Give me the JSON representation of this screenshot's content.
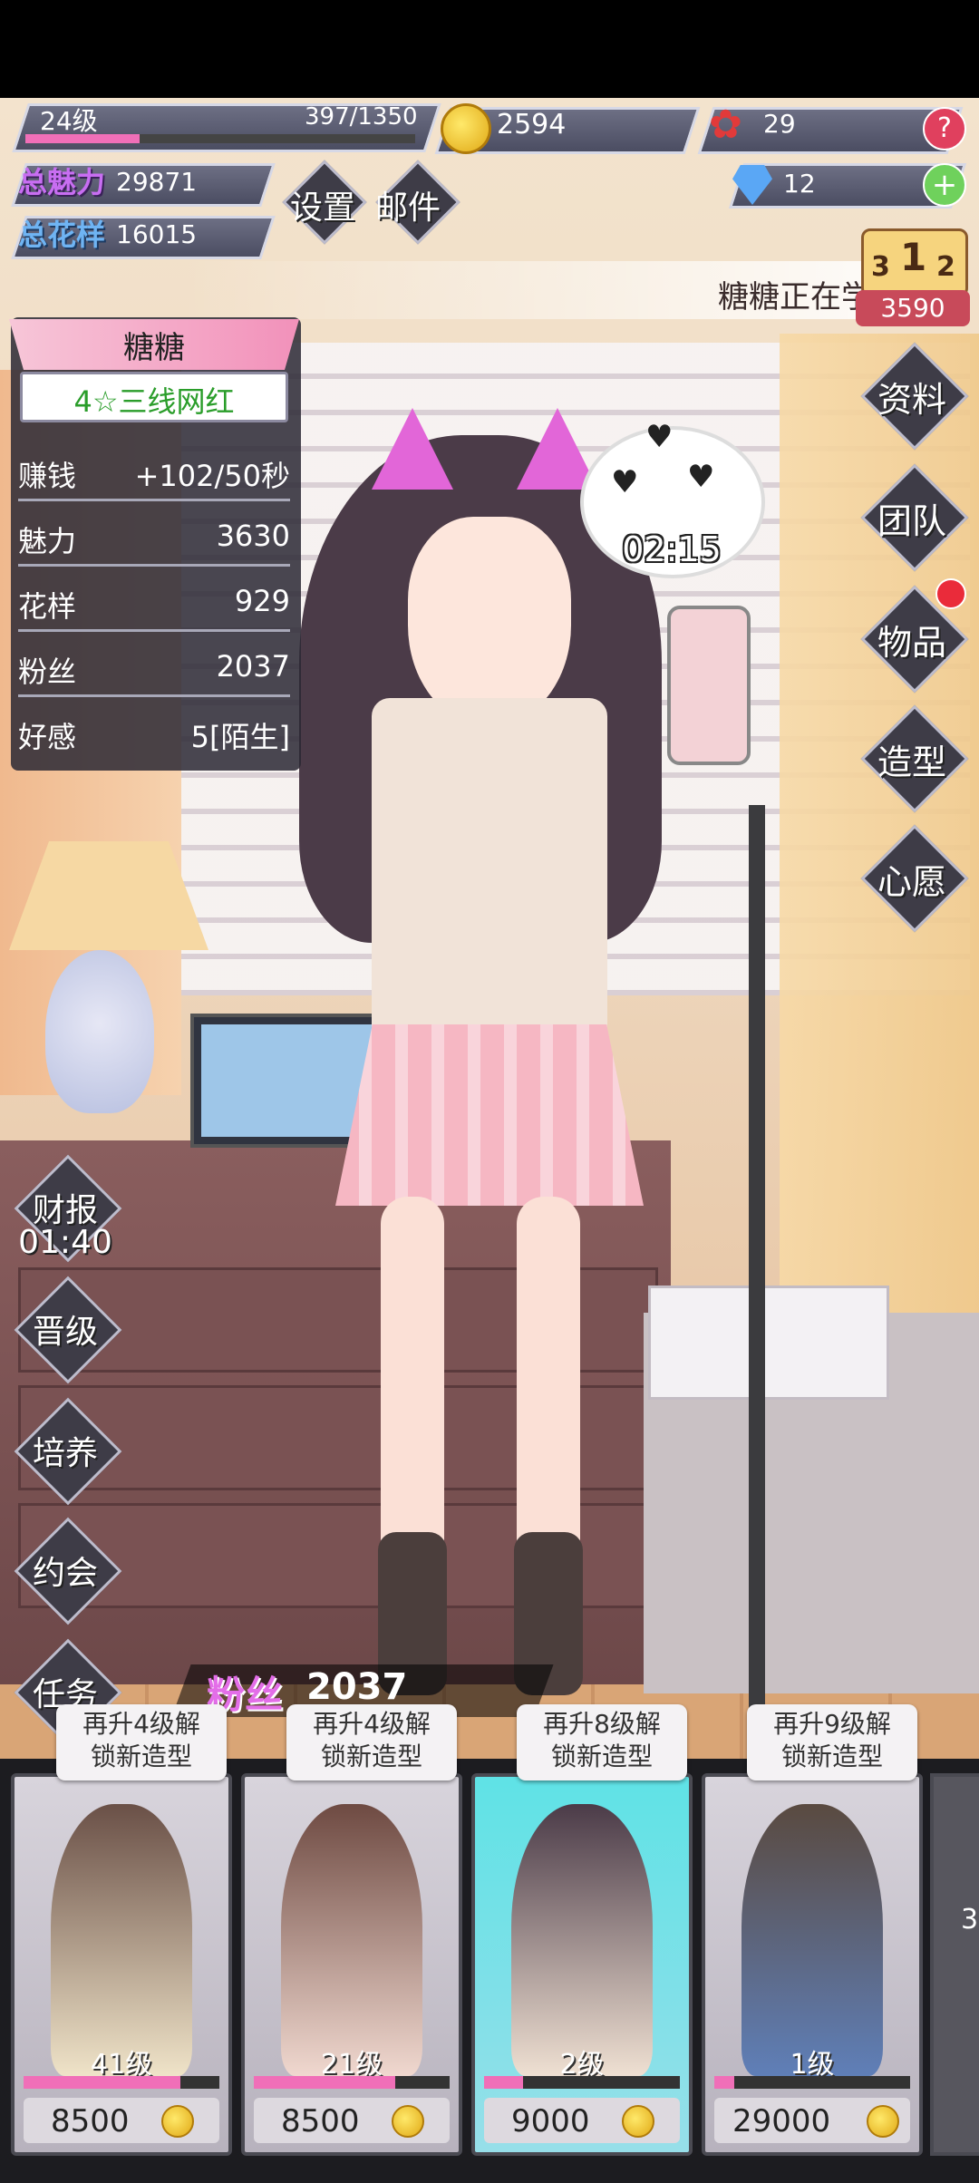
{
  "header": {
    "level": "24级",
    "exp": "397/1350",
    "exp_fraction": 0.294,
    "coins": "2594",
    "roses": "29",
    "diamonds": "12",
    "charm_label": "总魅力",
    "charm_value": "29871",
    "pattern_label": "总花样",
    "pattern_value": "16015",
    "settings": "设置",
    "mail": "邮件",
    "help_glyph": "?",
    "plus_glyph": "+"
  },
  "ticker": {
    "text": "糖糖正在学",
    "rank_digits": [
      "3",
      "1",
      "2"
    ],
    "rank_score": "3590"
  },
  "profile": {
    "name": "糖糖",
    "rank_title": "4☆三线网红",
    "stats": [
      {
        "label": "赚钱",
        "value": "+102/50秒"
      },
      {
        "label": "魅力",
        "value": "3630"
      },
      {
        "label": "花样",
        "value": "929"
      },
      {
        "label": "粉丝",
        "value": "2037"
      },
      {
        "label": "好感",
        "value": "5[陌生]"
      }
    ]
  },
  "bubble": {
    "time": "02:15"
  },
  "right_menu": [
    "资料",
    "团队",
    "物品",
    "造型",
    "心愿"
  ],
  "left_menu": {
    "report": "财报",
    "report_timer": "01:40",
    "promote": "晋级",
    "train": "培养",
    "date": "约会",
    "task": "任务"
  },
  "fans": {
    "label": "粉丝",
    "value": "2037"
  },
  "cards": [
    {
      "tip_line1": "再升4级解",
      "tip_line2": "锁新造型",
      "level": "41级",
      "progress": 0.8,
      "price": "8500"
    },
    {
      "tip_line1": "再升4级解",
      "tip_line2": "锁新造型",
      "level": "21级",
      "progress": 0.72,
      "price": "8500"
    },
    {
      "tip_line1": "再升8级解",
      "tip_line2": "锁新造型",
      "level": "2级",
      "progress": 0.2,
      "price": "9000"
    },
    {
      "tip_line1": "再升9级解",
      "tip_line2": "锁新造型",
      "level": "1级",
      "progress": 0.1,
      "price": "29000"
    }
  ],
  "partial_card_text": "3",
  "colors": {
    "accent_pink": "#f06fb8",
    "coin_gold": "#e0a815",
    "charm_purple": "#c86ef2",
    "pattern_blue": "#6fb4f3",
    "active_card": "#5fe2e6"
  }
}
